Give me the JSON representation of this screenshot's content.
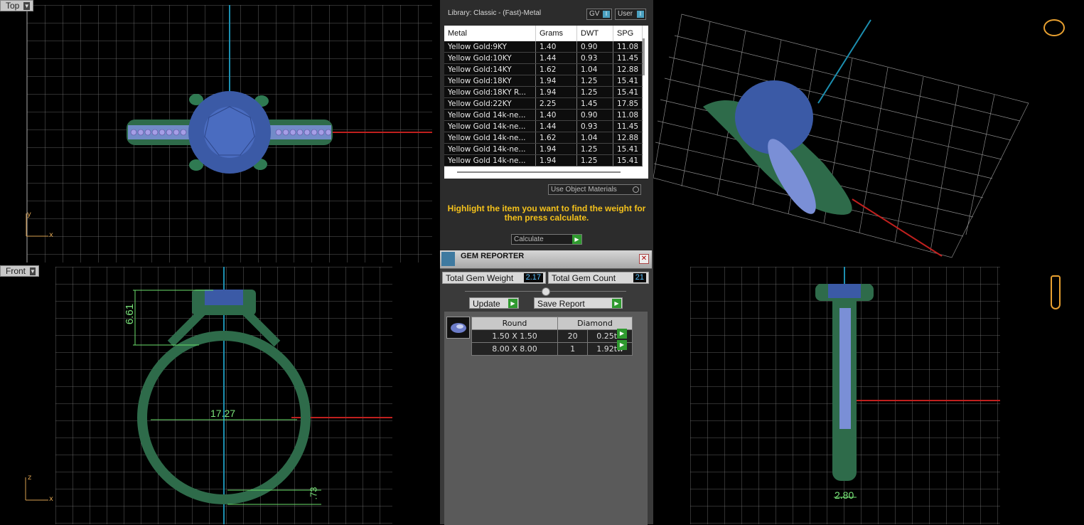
{
  "viewports": {
    "top": {
      "label": "Top"
    },
    "front": {
      "label": "Front",
      "dims": {
        "height": "6.61",
        "width": "17.27",
        "bottom": ".73"
      }
    },
    "right": {
      "dims": {
        "width": "2.80"
      }
    },
    "persp": {}
  },
  "axes": {
    "x": "x",
    "y": "y",
    "z": "z"
  },
  "library": {
    "title": "Library: Classic - (Fast)-Metal",
    "toggle_gv": "GV",
    "toggle_user": "User",
    "columns": [
      "Metal",
      "Grams",
      "DWT",
      "SPG"
    ],
    "rows": [
      [
        "Yellow Gold:9KY",
        "1.40",
        "0.90",
        "11.08"
      ],
      [
        "Yellow Gold:10KY",
        "1.44",
        "0.93",
        "11.45"
      ],
      [
        "Yellow Gold:14KY",
        "1.62",
        "1.04",
        "12.88"
      ],
      [
        "Yellow Gold:18KY",
        "1.94",
        "1.25",
        "15.41"
      ],
      [
        "Yellow Gold:18KY R...",
        "1.94",
        "1.25",
        "15.41"
      ],
      [
        "Yellow Gold:22KY",
        "2.25",
        "1.45",
        "17.85"
      ],
      [
        "Yellow Gold 14k-ne...",
        "1.40",
        "0.90",
        "11.08"
      ],
      [
        "Yellow Gold 14k-ne...",
        "1.44",
        "0.93",
        "11.45"
      ],
      [
        "Yellow Gold 14k-ne...",
        "1.62",
        "1.04",
        "12.88"
      ],
      [
        "Yellow Gold 14k-ne...",
        "1.94",
        "1.25",
        "15.41"
      ],
      [
        "Yellow Gold 14k-ne...",
        "1.94",
        "1.25",
        "15.41"
      ]
    ],
    "use_object_materials": "Use Object Materials",
    "hint": "Highlight the item you want to find the weight for then press calculate.",
    "calculate": "Calculate"
  },
  "gem_reporter": {
    "title": "GEM REPORTER",
    "total_weight_label": "Total Gem Weight",
    "total_weight": "2.17",
    "total_count_label": "Total Gem Count",
    "total_count": "21",
    "update": "Update",
    "save_report": "Save Report",
    "header": {
      "shape": "Round",
      "type": "Diamond"
    },
    "rows": [
      {
        "size": "1.50 X 1.50",
        "count": "20",
        "weight": "0.25tw"
      },
      {
        "size": "8.00 X 8.00",
        "count": "1",
        "weight": "1.92tw"
      }
    ]
  },
  "colors": {
    "metal": "#2e6b4a",
    "stone": "#3b5aa6",
    "accent_melee": "#8a7fd8",
    "grid": "#8a8a8a",
    "hint": "#f5c21b"
  }
}
